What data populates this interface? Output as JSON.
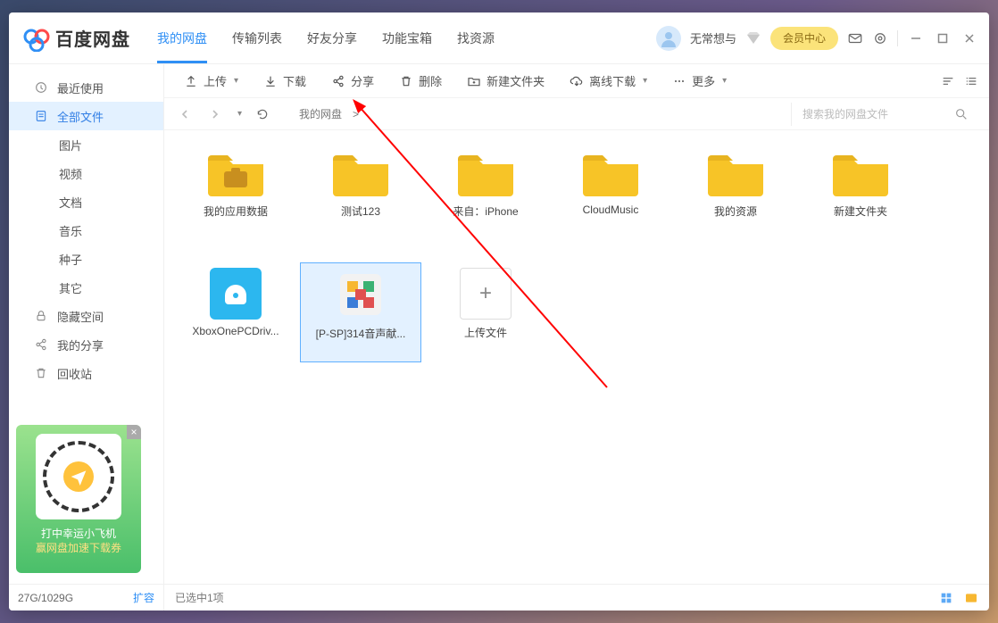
{
  "app": {
    "name": "百度网盘"
  },
  "tabs": [
    "我的网盘",
    "传输列表",
    "好友分享",
    "功能宝箱",
    "找资源"
  ],
  "activeTab": 0,
  "user": {
    "name": "无常想与",
    "vip_label": "会员中心"
  },
  "toolbar": {
    "upload": "上传",
    "download": "下载",
    "share": "分享",
    "delete": "删除",
    "newfolder": "新建文件夹",
    "offline": "离线下载",
    "more": "更多"
  },
  "path": {
    "root": "我的网盘",
    "sep": ">"
  },
  "search": {
    "placeholder": "搜索我的网盘文件"
  },
  "sidebar": {
    "items": [
      {
        "label": "最近使用",
        "icon": "clock"
      },
      {
        "label": "全部文件",
        "icon": "file",
        "active": true
      },
      {
        "label": "图片",
        "indent": true
      },
      {
        "label": "视频",
        "indent": true
      },
      {
        "label": "文档",
        "indent": true
      },
      {
        "label": "音乐",
        "indent": true
      },
      {
        "label": "种子",
        "indent": true
      },
      {
        "label": "其它",
        "indent": true
      },
      {
        "label": "隐藏空间",
        "icon": "lock"
      },
      {
        "label": "我的分享",
        "icon": "share"
      },
      {
        "label": "回收站",
        "icon": "trash"
      }
    ]
  },
  "promo": {
    "line1": "打中幸运小飞机",
    "line2": "赢网盘加速下载券"
  },
  "storage": {
    "used": "27G/1029G",
    "expand": "扩容"
  },
  "files": [
    {
      "name": "我的应用数据",
      "type": "folder-app"
    },
    {
      "name": "测试123",
      "type": "folder"
    },
    {
      "name": "来自：iPhone",
      "type": "folder"
    },
    {
      "name": "CloudMusic",
      "type": "folder"
    },
    {
      "name": "我的资源",
      "type": "folder"
    },
    {
      "name": "新建文件夹",
      "type": "folder"
    },
    {
      "name": "XboxOnePCDriv...",
      "type": "app"
    },
    {
      "name": "[P-SP]314音声献...",
      "type": "exe",
      "selected": true
    },
    {
      "name": "上传文件",
      "type": "upload"
    }
  ],
  "status": {
    "selection": "已选中1项"
  }
}
